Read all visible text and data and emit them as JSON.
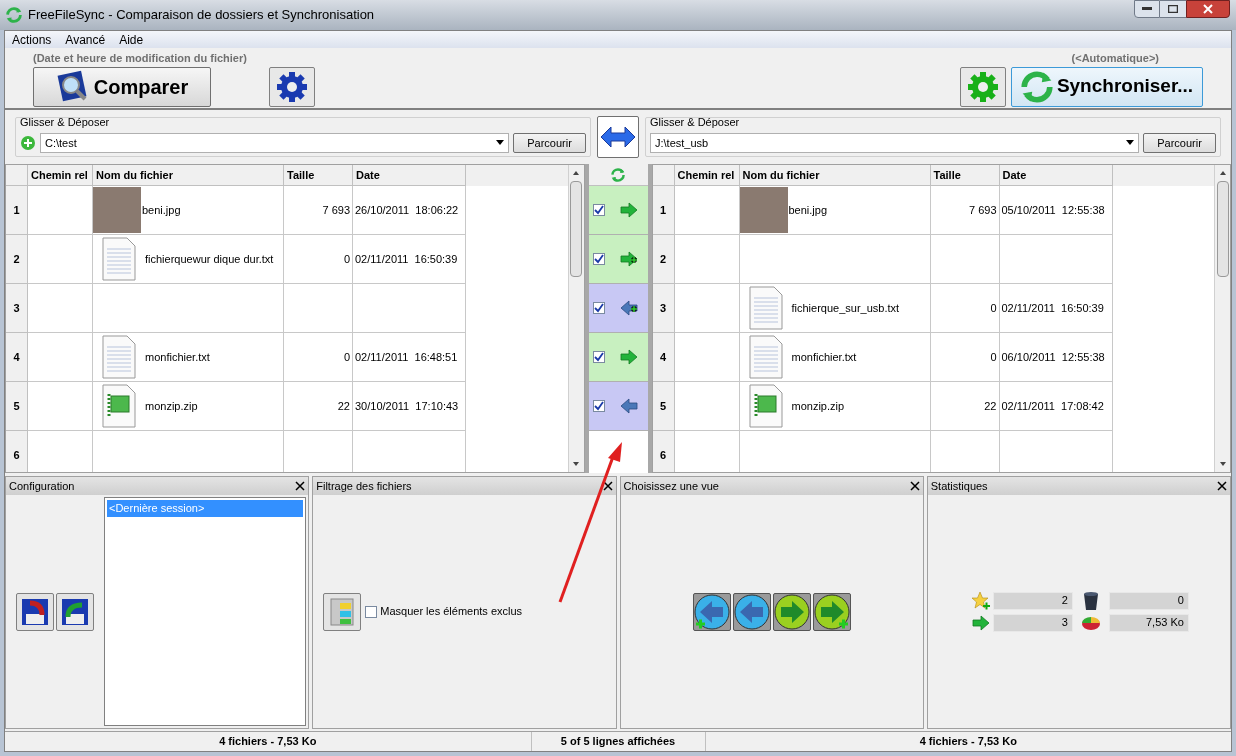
{
  "window": {
    "title": "FreeFileSync - Comparaison de dossiers et Synchronisation"
  },
  "menu": [
    {
      "label": "Actions"
    },
    {
      "label": "Avancé"
    },
    {
      "label": "Aide"
    }
  ],
  "toolbar": {
    "compare_variant": "(Date et heure de modification du fichier)",
    "compare_button": "Comparer",
    "sync_variant": "(<Automatique>)",
    "sync_button": "Synchroniser..."
  },
  "folders": [
    {
      "label": "Glisser & Déposer",
      "path": "C:\\test",
      "browse": "Parcourir"
    },
    {
      "label": "Glisser & Déposer",
      "path": "J:\\test_usb",
      "browse": "Parcourir"
    }
  ],
  "grids": [
    {
      "columns": [
        "Chemin rel",
        "Nom du fichier",
        "Taille",
        "Date"
      ],
      "rows": [
        {
          "num": "1",
          "kind": "photo",
          "name": "beni.jpg",
          "size": "7 693",
          "date": "26/10/2011  18:06:22"
        },
        {
          "num": "2",
          "kind": "text",
          "name": "fichierquewur dique dur.txt",
          "size": "0",
          "date": "02/11/2011  16:50:39"
        },
        {
          "num": "3"
        },
        {
          "num": "4",
          "kind": "text",
          "name": "monfichier.txt",
          "size": "0",
          "date": "02/11/2011  16:48:51"
        },
        {
          "num": "5",
          "kind": "zip",
          "name": "monzip.zip",
          "size": "22",
          "date": "30/10/2011  17:10:43"
        },
        {
          "num": "6"
        }
      ]
    },
    {
      "columns": [
        "Chemin rel",
        "Nom du fichier",
        "Taille",
        "Date"
      ],
      "rows": [
        {
          "num": "1",
          "kind": "photo",
          "name": "beni.jpg",
          "size": "7 693",
          "date": "05/10/2011  12:55:38"
        },
        {
          "num": "2"
        },
        {
          "num": "3",
          "kind": "text",
          "name": "fichierque_sur_usb.txt",
          "size": "0",
          "date": "02/11/2011  16:50:39"
        },
        {
          "num": "4",
          "kind": "text",
          "name": "monfichier.txt",
          "size": "0",
          "date": "06/10/2011  12:55:38"
        },
        {
          "num": "5",
          "kind": "zip",
          "name": "monzip.zip",
          "size": "22",
          "date": "02/11/2011  17:08:42"
        },
        {
          "num": "6"
        }
      ]
    }
  ],
  "actions": [
    {
      "checked": true,
      "kind": "right"
    },
    {
      "checked": true,
      "kind": "right-new"
    },
    {
      "checked": true,
      "kind": "left-new"
    },
    {
      "checked": true,
      "kind": "right"
    },
    {
      "checked": true,
      "kind": "left"
    }
  ],
  "configuration": {
    "title": "Configuration",
    "sessions": [
      {
        "label": "<Dernière session>",
        "selected": true
      }
    ]
  },
  "filter": {
    "title": "Filtrage des fichiers",
    "hide_excluded": {
      "label": "Masquer les éléments exclus",
      "checked": false
    }
  },
  "view": {
    "title": "Choisissez une vue"
  },
  "statistics": {
    "title": "Statistiques",
    "items": [
      {
        "kind": "create",
        "value": "2"
      },
      {
        "kind": "delete",
        "value": "0"
      },
      {
        "kind": "update",
        "value": "3"
      },
      {
        "kind": "size",
        "value": "7,53 Ko"
      }
    ]
  },
  "status_bar": [
    "4 fichiers - 7,53 Ko",
    "5 of 5 lignes affichées",
    "4 fichiers - 7,53 Ko"
  ]
}
